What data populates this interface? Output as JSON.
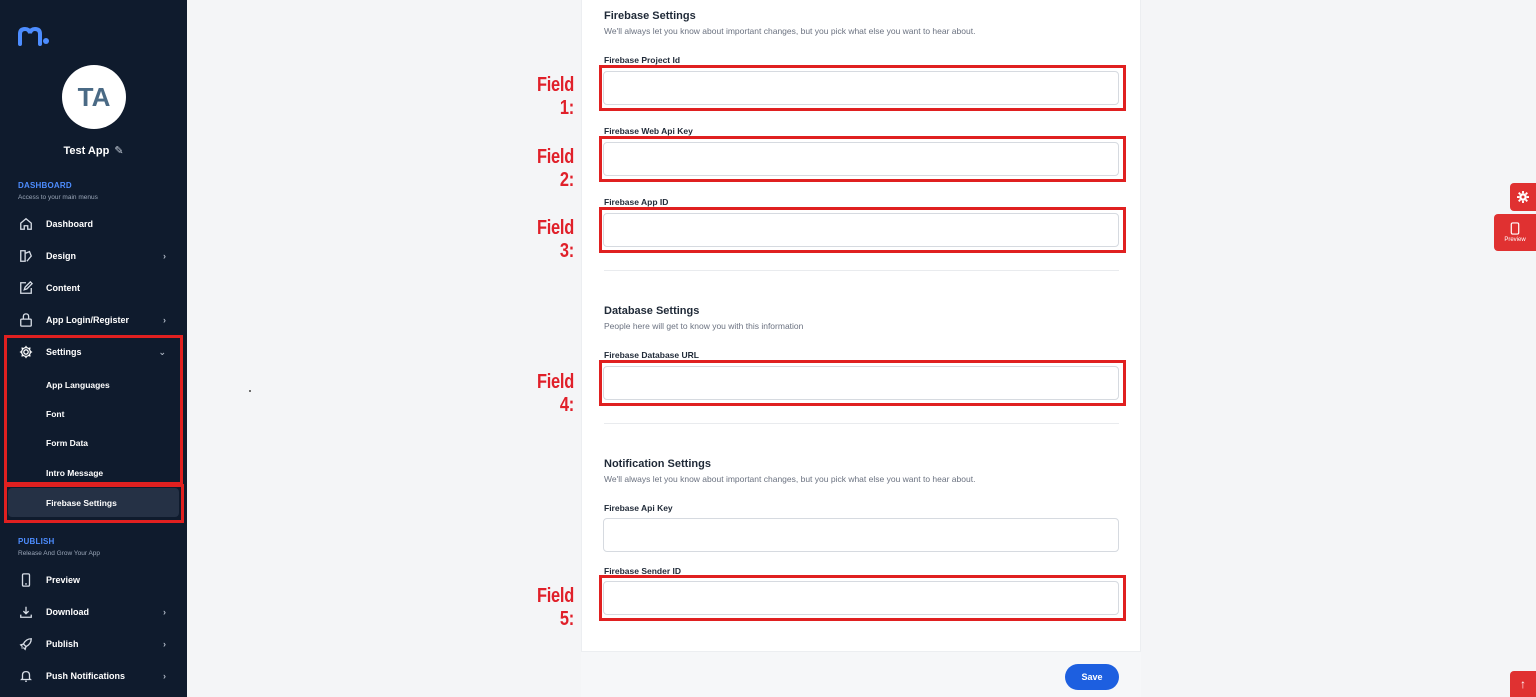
{
  "app": {
    "avatar_initials": "TA",
    "name": "Test App"
  },
  "sidebar": {
    "dashboard_section": {
      "title": "DASHBOARD",
      "subtitle": "Access to your main menus"
    },
    "publish_section": {
      "title": "PUBLISH",
      "subtitle": "Release And Grow Your App"
    },
    "items": [
      {
        "label": "Dashboard",
        "icon": "home-icon"
      },
      {
        "label": "Design",
        "icon": "design-icon",
        "chevron": "›"
      },
      {
        "label": "Content",
        "icon": "edit-square-icon"
      },
      {
        "label": "App Login/Register",
        "icon": "lock-icon",
        "chevron": "›"
      },
      {
        "label": "Settings",
        "icon": "gear-icon",
        "chevron": "⌄"
      }
    ],
    "settings_sub": [
      {
        "label": "App Languages"
      },
      {
        "label": "Font"
      },
      {
        "label": "Form Data"
      },
      {
        "label": "Intro Message"
      },
      {
        "label": "Firebase Settings",
        "active": true
      }
    ],
    "publish_items": [
      {
        "label": "Preview",
        "icon": "phone-icon"
      },
      {
        "label": "Download",
        "icon": "download-icon",
        "chevron": "›"
      },
      {
        "label": "Publish",
        "icon": "rocket-icon",
        "chevron": "›"
      },
      {
        "label": "Push Notifications",
        "icon": "bell-icon",
        "chevron": "›"
      }
    ]
  },
  "form": {
    "firebase": {
      "title": "Firebase Settings",
      "description": "We'll always let you know about important changes, but you pick what else you want to hear about.",
      "fields": [
        {
          "label": "Firebase Project Id",
          "value": ""
        },
        {
          "label": "Firebase Web Api Key",
          "value": ""
        },
        {
          "label": "Firebase App ID",
          "value": ""
        }
      ]
    },
    "database": {
      "title": "Database Settings",
      "description": "People here will get to know you with this information",
      "fields": [
        {
          "label": "Firebase Database URL",
          "value": ""
        }
      ]
    },
    "notification": {
      "title": "Notification Settings",
      "description": "We'll always let you know about important changes, but you pick what else you want to hear about.",
      "fields": [
        {
          "label": "Firebase Api Key",
          "value": ""
        },
        {
          "label": "Firebase Sender ID",
          "value": ""
        }
      ]
    },
    "save_label": "Save"
  },
  "annotations": {
    "field_1": "Field 1:",
    "field_2": "Field 2:",
    "field_3": "Field 3:",
    "field_4": "Field 4:",
    "field_5": "Field 5:"
  },
  "floating": {
    "preview_label": "Preview"
  },
  "colors": {
    "sidebar_bg": "#0f1b2d",
    "accent_blue": "#1d5fe0",
    "annotation_red": "#e02020"
  }
}
